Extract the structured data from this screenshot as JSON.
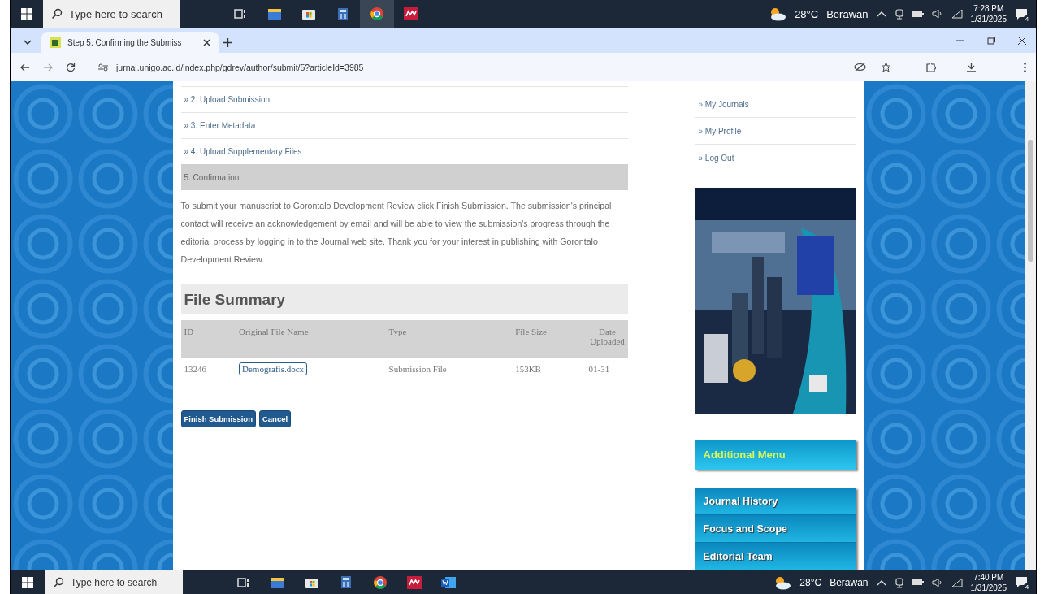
{
  "taskbar_top": {
    "search_placeholder": "Type here to search",
    "apps": [
      {
        "kind": "task-view",
        "selected": false
      },
      {
        "kind": "folder",
        "selected": false
      },
      {
        "kind": "store",
        "selected": false
      },
      {
        "kind": "calculator",
        "selected": false
      },
      {
        "kind": "browser",
        "selected": true
      },
      {
        "kind": "red-app",
        "selected": false
      }
    ],
    "temperature": "28°C",
    "weather": "Berawan",
    "time": "7:28 PM",
    "date": "1/31/2025",
    "notification_count": "4"
  },
  "browser": {
    "tabs": [
      {
        "title": "Step 5. Confirming the Submiss",
        "selected": true
      }
    ],
    "url": "jurnal.unigo.ac.id/index.php/gdrev/author/submit/5?articleId=3985"
  },
  "page": {
    "steps": [
      {
        "label": "» 2. Upload Submission",
        "selected": false
      },
      {
        "label": "» 3. Enter Metadata",
        "selected": false
      },
      {
        "label": "» 4. Upload Supplementary Files",
        "selected": false
      },
      {
        "label": "5. Confirmation",
        "selected": true
      }
    ],
    "message": "To submit your manuscript to Gorontalo Development Review click Finish Submission. The submission's principal contact will receive an acknowledgement by email and will be able to view the submission's progress through the editorial process by logging in to the Journal web site. Thank you for your interest in publishing with Gorontalo Development Review.",
    "file_summary": {
      "title": "File Summary",
      "columns": [
        "ID",
        "Original File Name",
        "Type",
        "File Size",
        "Date Uploaded"
      ],
      "rows": [
        {
          "id": "13246",
          "file_name": "Demografis.docx",
          "focused": true,
          "type": "Submission File",
          "size": "153KB",
          "date": "01-31"
        }
      ]
    },
    "buttons": [
      "Finish Submission",
      "Cancel"
    ]
  },
  "sidebar": {
    "user_links": [
      "» My Journals",
      "» My Profile",
      "» Log Out"
    ],
    "poster": {
      "kind": "picture"
    },
    "menu_heading": "Additional Menu",
    "menu_items": [
      "Journal History",
      "Focus and Scope",
      "Editorial Team"
    ]
  },
  "taskbar_bottom": {
    "search_placeholder": "Type here to search",
    "apps": [
      {
        "kind": "task-view",
        "selected": false
      },
      {
        "kind": "folder",
        "selected": false
      },
      {
        "kind": "store",
        "selected": false
      },
      {
        "kind": "calculator",
        "selected": false
      },
      {
        "kind": "browser",
        "selected": false
      },
      {
        "kind": "red-app",
        "selected": false
      },
      {
        "kind": "word",
        "selected": false
      }
    ],
    "temperature": "28°C",
    "weather": "Berawan",
    "time": "7:40 PM",
    "date": "1/31/2025",
    "notification_count": "4"
  }
}
